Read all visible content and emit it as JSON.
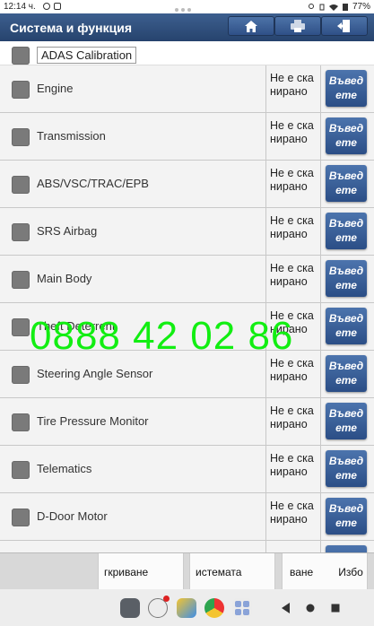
{
  "status": {
    "time": "12:14 ч.",
    "battery": "77%"
  },
  "header": {
    "title": "Система и функция",
    "buttons": [
      "home-icon",
      "printer-icon",
      "exit-icon"
    ]
  },
  "adas_label": "ADAS Calibration",
  "rows": [
    {
      "name": "Engine",
      "status": "Не е ска нирано",
      "action": "Въвед ете"
    },
    {
      "name": "Transmission",
      "status": "Не е ска нирано",
      "action": "Въвед ете"
    },
    {
      "name": "ABS/VSC/TRAC/EPB",
      "status": "Не е ска нирано",
      "action": "Въвед ете"
    },
    {
      "name": "SRS Airbag",
      "status": "Не е ска нирано",
      "action": "Въвед ете"
    },
    {
      "name": "Main Body",
      "status": "Не е ска нирано",
      "action": "Въвед ете"
    },
    {
      "name": "Theft Deterrent",
      "status": "Не е ска нирано",
      "action": "Въвед ете"
    },
    {
      "name": "Steering Angle Sensor",
      "status": "Не е ска нирано",
      "action": "Въвед ете"
    },
    {
      "name": "Tire Pressure Monitor",
      "status": "Не е ска нирано",
      "action": "Въвед ете"
    },
    {
      "name": "Telematics",
      "status": "Не е ска нирано",
      "action": "Въвед ете"
    },
    {
      "name": "D-Door Motor",
      "status": "Не е ска нирано",
      "action": "Въвед ете"
    }
  ],
  "watermark": "0888 42 02 86",
  "bottom": {
    "b1": "гкриване",
    "b2": "истемата",
    "b3": "ване",
    "b4": "Избо"
  },
  "colors": {
    "header": "#2f4f7f",
    "enter_button": "#2f5287",
    "watermark": "#12ee12"
  }
}
